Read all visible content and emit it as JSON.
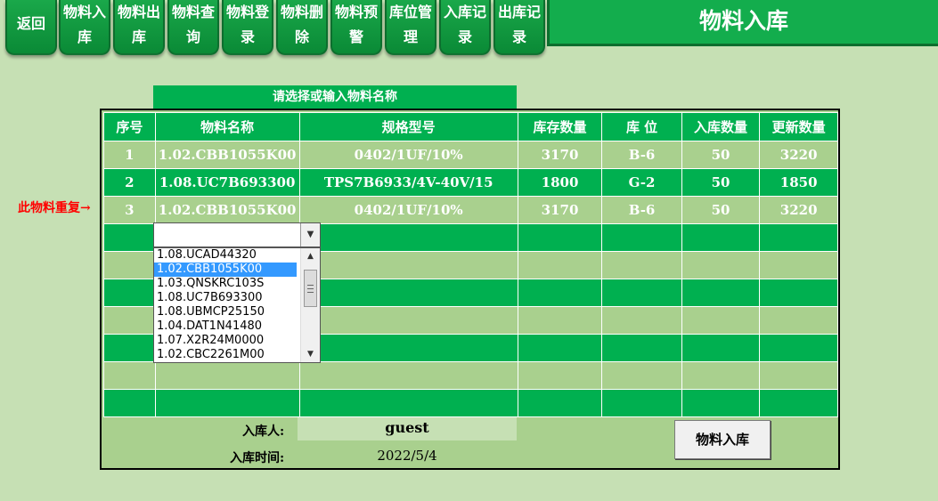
{
  "nav": {
    "back": "返回",
    "buttons": [
      {
        "line1": "物料入",
        "line2": "库"
      },
      {
        "line1": "物料出",
        "line2": "库"
      },
      {
        "line1": "物料查",
        "line2": "询"
      },
      {
        "line1": "物料登",
        "line2": "录"
      },
      {
        "line1": "物料删",
        "line2": "除"
      },
      {
        "line1": "物料预",
        "line2": "警"
      },
      {
        "line1": "库位管",
        "line2": "理"
      },
      {
        "line1": "入库记",
        "line2": "录"
      },
      {
        "line1": "出库记",
        "line2": "录"
      }
    ]
  },
  "page_title": "物料入库",
  "hint": "请选择或输入物料名称",
  "table": {
    "headers": [
      "序号",
      "物料名称",
      "规格型号",
      "库存数量",
      "库 位",
      "入库数量",
      "更新数量"
    ],
    "rows": [
      [
        "1",
        "1.02.CBB1055K00",
        "0402/1UF/10%",
        "3170",
        "B-6",
        "50",
        "3220"
      ],
      [
        "2",
        "1.08.UC7B693300",
        "TPS7B6933/4V-40V/15",
        "1800",
        "G-2",
        "50",
        "1850"
      ],
      [
        "3",
        "1.02.CBB1055K00",
        "0402/1UF/10%",
        "3170",
        "B-6",
        "50",
        "3220"
      ]
    ]
  },
  "duplicate_note": "此物料重复→",
  "combo": {
    "value": "",
    "options": [
      "1.08.UCAD44320",
      "1.02.CBB1055K00",
      "1.03.QNSKRC103S",
      "1.08.UC7B693300",
      "1.08.UBMCP25150",
      "1.04.DAT1N41480",
      "1.07.X2R24M0000",
      "1.02.CBC2261M00"
    ],
    "selected": "1.02.CBB1055K00"
  },
  "footer": {
    "operator_label": "入库人:",
    "operator_value": "guest",
    "time_label": "入库时间:",
    "time_value": "2022/5/4"
  },
  "submit_label": "物料入库",
  "colors": {
    "green": "#00b050",
    "light_green": "#a9d08e",
    "background": "#c6e0b4",
    "warning": "#ff0000"
  }
}
